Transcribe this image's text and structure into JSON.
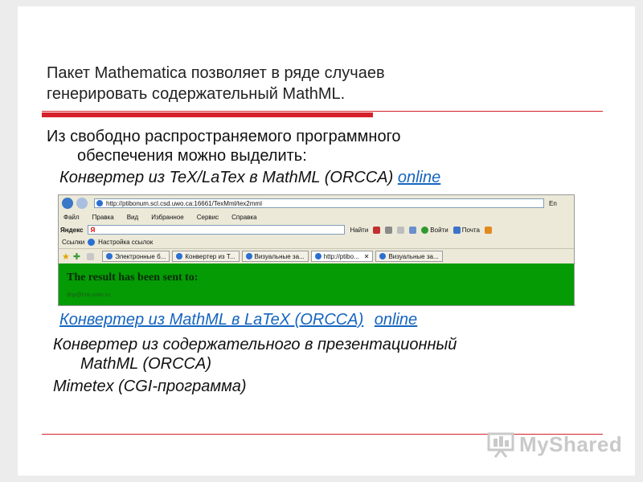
{
  "slide": {
    "title_line1": "Пакет Mathematica позволяет в ряде случаев",
    "title_line2": "генерировать содержательный MathML.",
    "intro_line1": "Из свободно распространяемого программного",
    "intro_line2": "обеспечения можно выделить:",
    "item1_text": "Конвертер из TeX/LaTex в MathML (ORCCA)",
    "item1_link": "online",
    "item2_text": "Конвертер из MathML в LaTeX (ORCCA)",
    "item2_link": "online",
    "item3_line1": "Конвертер из содержательного в презентационный",
    "item3_line2": "MathML (ORCCA)",
    "item4_text": "Mimetex (CGI-программа)"
  },
  "browser": {
    "address": "http://ptibonum.scl.csd.uwo.ca:16661/TexMml/tex2mml",
    "lang": "En",
    "menu": [
      "Файл",
      "Правка",
      "Вид",
      "Избранное",
      "Сервис",
      "Справка"
    ],
    "yandex_label": "Яндекс",
    "yandex_value": "Я",
    "toolbar_login": "Найти",
    "toolbar_enter": "Войти",
    "toolbar_mail": "Почта",
    "links_label": "Ссылки",
    "links_setup": "Настройка ссылок",
    "tabs": [
      "Электронные б...",
      "Конвертер из T...",
      "Визуальные за...",
      "http://ptibo...",
      "Визуальные за..."
    ],
    "page_message": "The result has been sent to:",
    "page_email": "dnp@ims.uran.ru"
  },
  "logo": {
    "text": "MyShared"
  },
  "colors": {
    "accent": "#d6202a",
    "link": "#1565c0",
    "page_green": "#049b04"
  }
}
